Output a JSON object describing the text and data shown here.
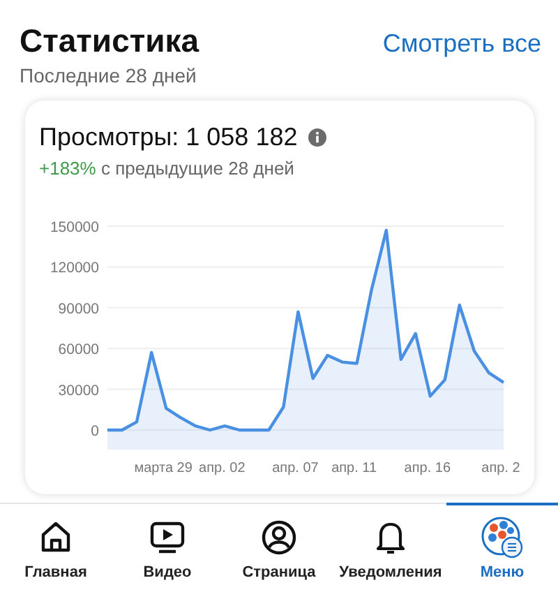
{
  "header": {
    "title": "Статистика",
    "link": "Смотреть все",
    "subtitle": "Последние 28 дней"
  },
  "card": {
    "title": "Просмотры: 1 058 182",
    "change": "+183%",
    "change_text": "с предыдущие 28 дней",
    "chart_data": {
      "type": "area",
      "categories": [
        null,
        null,
        null,
        null,
        "марта 29",
        null,
        null,
        null,
        "апр. 02",
        null,
        null,
        null,
        null,
        "апр. 07",
        null,
        null,
        null,
        "апр. 11",
        null,
        null,
        null,
        null,
        "апр. 16",
        null,
        null,
        null,
        null,
        "апр. 2"
      ],
      "series": [
        {
          "color": "#4a90e2",
          "values": [
            0,
            0,
            6000,
            57000,
            16000,
            9000,
            3000,
            0,
            3000,
            0,
            0,
            0,
            17000,
            87000,
            38000,
            55000,
            50000,
            49000,
            103000,
            147000,
            52000,
            71000,
            25000,
            37000,
            92000,
            58000,
            42000,
            35000
          ]
        }
      ],
      "grid": true,
      "ylim": [
        0,
        150000
      ],
      "yticks": [
        0,
        30000,
        60000,
        90000,
        120000,
        150000
      ]
    }
  },
  "nav": [
    {
      "label": "Главная",
      "kind": "home",
      "selected": false
    },
    {
      "label": "Видео",
      "kind": "video",
      "selected": false
    },
    {
      "label": "Страница",
      "kind": "profile",
      "selected": false
    },
    {
      "label": "Уведомления",
      "kind": "bell",
      "selected": false
    },
    {
      "label": "Меню",
      "kind": "menu",
      "selected": true
    }
  ]
}
